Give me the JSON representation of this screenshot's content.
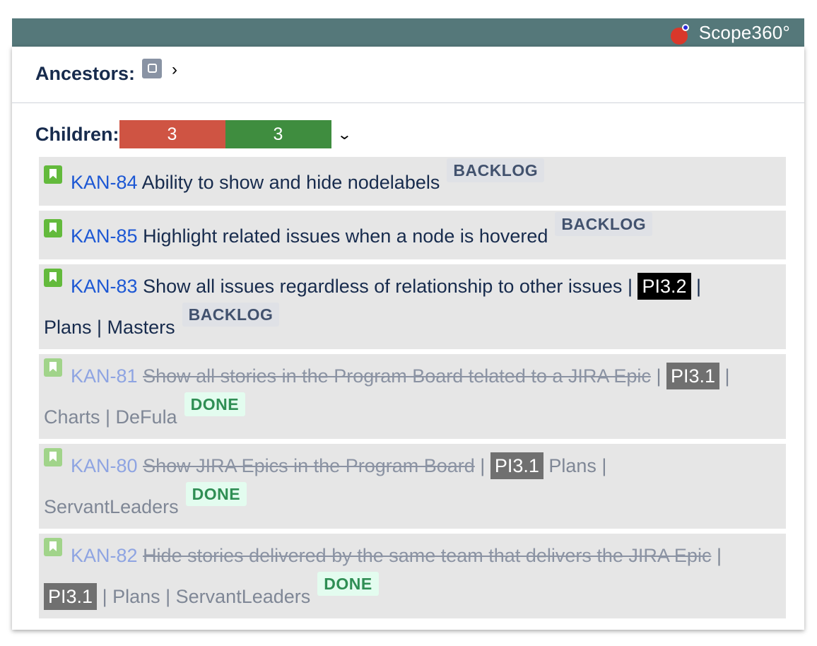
{
  "header": {
    "brand": "Scope360°"
  },
  "ancestors": {
    "label": "Ancestors:"
  },
  "children": {
    "label": "Children:",
    "counts": [
      {
        "value": "3",
        "color": "#cf5443"
      },
      {
        "value": "3",
        "color": "#3f8d3f"
      }
    ]
  },
  "items": [
    {
      "key": "KAN-84",
      "summary": "Ability to show and hide nodelabels",
      "status": "BACKLOG"
    },
    {
      "key": "KAN-85",
      "summary": "Highlight related issues when a node is hovered",
      "status": "BACKLOG"
    },
    {
      "key": "KAN-83",
      "summary": "Show all issues regardless of relationship to other issues",
      "pi": "PI3.2",
      "tags": "Plans | Masters",
      "status": "BACKLOG"
    },
    {
      "key": "KAN-81",
      "summary": "Show all stories in the Program Board telated to a JIRA Epic",
      "pi": "PI3.1",
      "tags": "Charts | DeFula",
      "status": "DONE"
    },
    {
      "key": "KAN-80",
      "summary": "Show JIRA Epics in the Program Board",
      "pi": "PI3.1",
      "tags_inline": "Plans |",
      "tags": "ServantLeaders",
      "status": "DONE"
    },
    {
      "key": "KAN-82",
      "summary": "Hide stories delivered by the same team that delivers the JIRA Epic",
      "pi": "PI3.1",
      "tags": "Plans | ServantLeaders",
      "status": "DONE"
    }
  ]
}
